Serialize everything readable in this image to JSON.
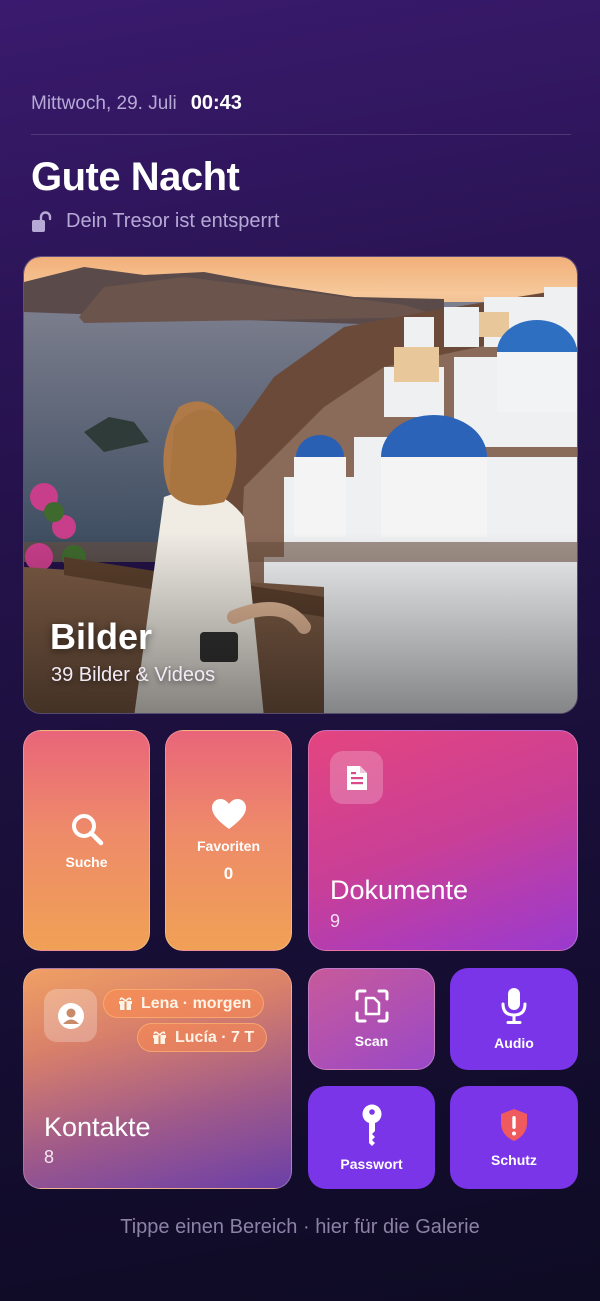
{
  "header": {
    "date": "Mittwoch, 29. Juli",
    "time": "00:43",
    "greeting": "Gute Nacht",
    "lock_status": "Dein Tresor ist entsperrt"
  },
  "photos": {
    "title": "Bilder",
    "subtitle": "39 Bilder & Videos"
  },
  "search": {
    "label": "Suche",
    "icon": "search-icon"
  },
  "favorites": {
    "label": "Favoriten",
    "count": "0",
    "icon": "heart-icon"
  },
  "documents": {
    "title": "Dokumente",
    "count": "9",
    "icon": "document-icon"
  },
  "contacts": {
    "title": "Kontakte",
    "count": "8",
    "birthdays": [
      "Lena · morgen",
      "Lucía · 7 T"
    ],
    "icon": "person-icon"
  },
  "scan": {
    "label": "Scan",
    "icon": "scan-icon"
  },
  "audio": {
    "label": "Audio",
    "icon": "microphone-icon"
  },
  "password": {
    "label": "Passwort",
    "icon": "key-icon"
  },
  "protection": {
    "label": "Schutz",
    "icon": "shield-alert-icon"
  },
  "footer": {
    "hint": "Tippe einen Bereich · hier für die Galerie"
  },
  "colors": {
    "accent_purple": "#7a35e8",
    "accent_pink": "#e4457f",
    "accent_orange": "#f0a155"
  }
}
